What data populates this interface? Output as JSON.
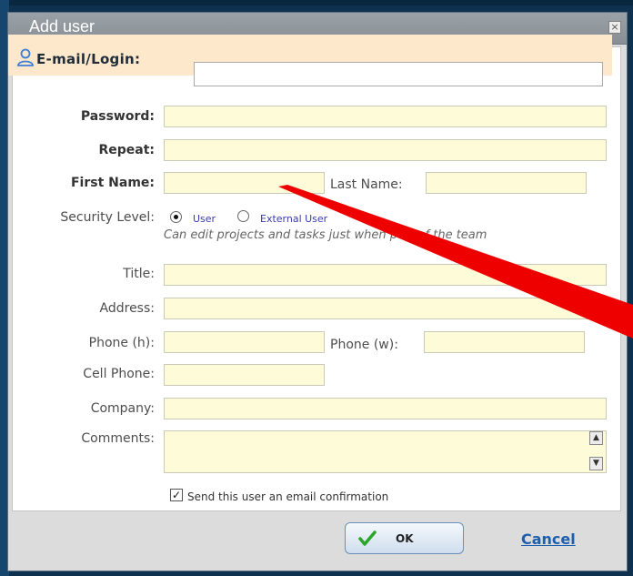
{
  "dialog": {
    "title": "Add user",
    "close_glyph": "×"
  },
  "login": {
    "label": "E-mail/Login:",
    "icon": "user-icon"
  },
  "fields": {
    "password": "Password:",
    "repeat": "Repeat:",
    "first_name": "First Name:",
    "last_name": "Last Name:",
    "security_level": "Security Level:",
    "title": "Title:",
    "address": "Address:",
    "phone_h": "Phone (h):",
    "phone_w": "Phone (w):",
    "cell_phone": "Cell Phone:",
    "company": "Company:",
    "comments": "Comments:"
  },
  "security": {
    "options": [
      "User",
      "External User"
    ],
    "selected": "User",
    "hint": "Can edit projects and tasks just when part of the team"
  },
  "email_confirmation": {
    "label": "Send this user an email confirmation",
    "checked": true
  },
  "buttons": {
    "ok": "OK",
    "cancel": "Cancel"
  },
  "colors": {
    "accent_link": "#1d5fae",
    "field_bg": "#fdfbd8",
    "email_band_bg": "#fde8cc",
    "overlay_slash": "#ee0000"
  }
}
